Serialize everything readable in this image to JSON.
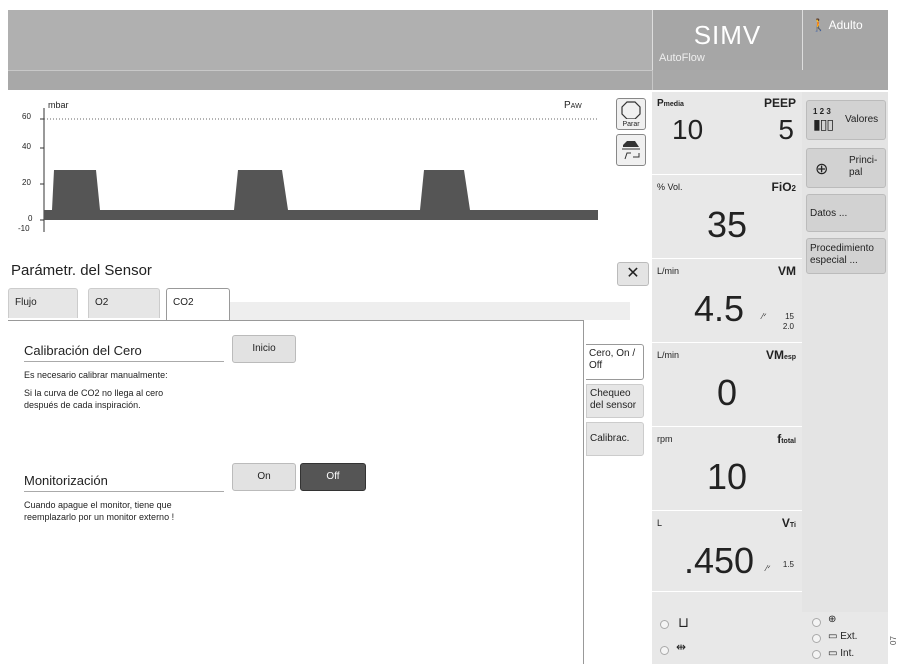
{
  "header": {
    "mode": "SIMV",
    "mode_sub": "AutoFlow",
    "patient": "Adulto"
  },
  "waveform": {
    "unit": "mbar",
    "label": "P",
    "label_sub": "AW",
    "y_ticks": [
      "60",
      "40",
      "20",
      "0",
      "-10"
    ],
    "stop_label": "Parar"
  },
  "values": [
    {
      "unit": "P",
      "unit_sub": "media",
      "name": "PEEP",
      "value1": "10",
      "value2": "5"
    },
    {
      "unit": "% Vol.",
      "name": "FiO",
      "name_sub": "2",
      "value": "35"
    },
    {
      "unit": "L/min",
      "name": "VM",
      "value": "4.5",
      "lim_hi": "15",
      "lim_lo": "2.0"
    },
    {
      "unit": "L/min",
      "name": "VM",
      "name_sub": "esp",
      "value": "0"
    },
    {
      "unit": "rpm",
      "name": "f",
      "name_sub": "total",
      "value": "10"
    },
    {
      "unit": "L",
      "name": "V",
      "name_sub": "Ti",
      "value": ".450",
      "lim": "1.5"
    }
  ],
  "menu": {
    "valores": "Valores",
    "principal": "Princi-\npal",
    "datos": "Datos ...",
    "procedimiento": "Procedimiento especial ..."
  },
  "panel": {
    "title": "Parámetr. del Sensor",
    "close": "✕",
    "tabs": [
      "Flujo",
      "O2",
      "CO2"
    ],
    "side_tabs": [
      "Cero, On / Off",
      "Chequeo del sensor",
      "Calibrac."
    ],
    "calib_title": "Calibración del Cero",
    "calib_button": "Inicio",
    "calib_note_1": "Es necesario calibrar manualmente:",
    "calib_note_2": "Si la curva de CO2 no llega al cero",
    "calib_note_3": "después de cada inspiración.",
    "monitor_title": "Monitorización",
    "on_label": "On",
    "off_label": "Off",
    "monitor_note_1": "Cuando apague el monitor, tiene que",
    "monitor_note_2": "reemplazarlo por un monitor externo !"
  },
  "status": {
    "ext": "Ext.",
    "int": "Int."
  },
  "side_number": "07"
}
